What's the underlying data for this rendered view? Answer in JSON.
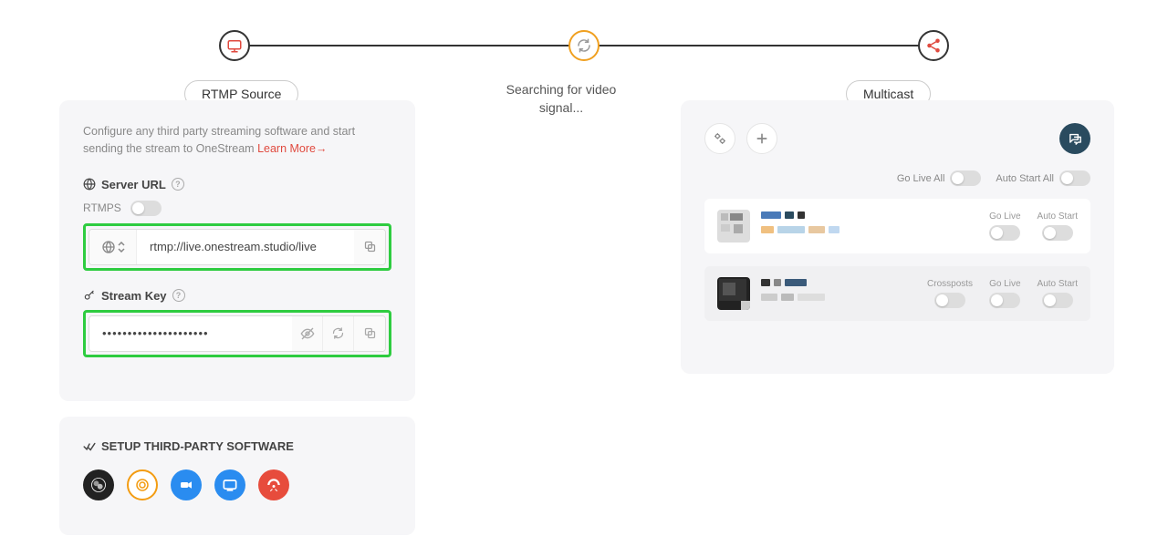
{
  "steps": {
    "left_label": "RTMP Source",
    "center_label": "Searching for video signal...",
    "right_label": "Multicast"
  },
  "rtmp": {
    "desc": "Configure any third party streaming software and start sending the stream to OneStream ",
    "learn_more": "Learn More→",
    "server_url_label": "Server URL",
    "rtmps_label": "RTMPS",
    "server_url": "rtmp://live.onestream.studio/live",
    "stream_key_label": "Stream Key",
    "stream_key_masked": "•••••••••••••••••••••"
  },
  "third_party": {
    "title": "SETUP THIRD-PARTY SOFTWARE"
  },
  "multicast": {
    "go_live_all": "Go Live All",
    "auto_start_all": "Auto Start All",
    "go_live": "Go Live",
    "auto_start": "Auto Start",
    "crossposts": "Crossposts"
  }
}
